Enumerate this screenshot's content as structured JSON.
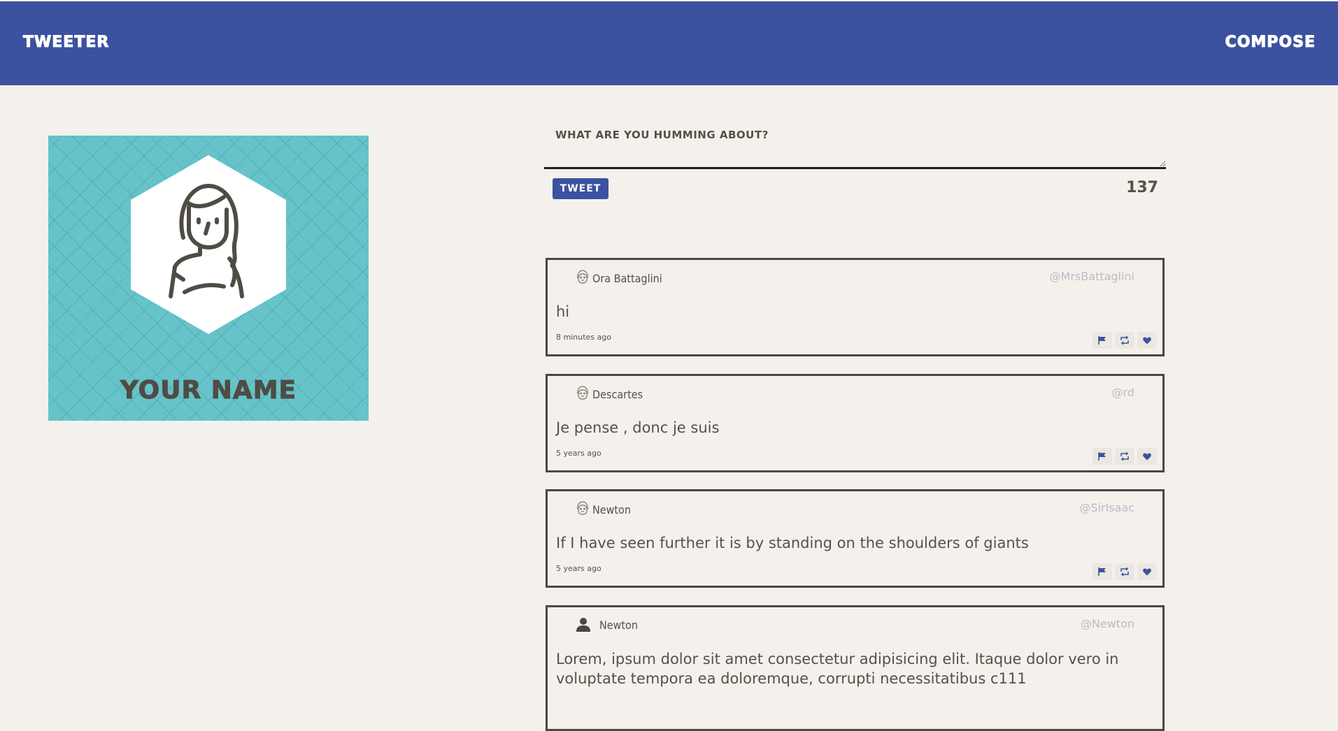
{
  "nav": {
    "logo": "Tweeter",
    "compose": "Compose"
  },
  "profile": {
    "name": "Your name",
    "avatar_icon": "woman-avatar-icon"
  },
  "composer": {
    "placeholder": "What are you humming about?",
    "value": "",
    "button_label": "Tweet",
    "remaining_chars": "137"
  },
  "colors": {
    "nav_bg": "#3b52a0",
    "page_bg": "#f4f1ec",
    "profile_bg": "#66c3c9",
    "text": "#545149",
    "handle": "#b9bcc9"
  },
  "tweets": [
    {
      "author": "Ora Battaglini",
      "handle": "@MrsBattaglini",
      "content": "hi",
      "time": "8 minutes ago",
      "avatar_icon": "face-avatar-icon"
    },
    {
      "author": "Descartes",
      "handle": "@rd",
      "content": "Je pense , donc je suis",
      "time": "5 years ago",
      "avatar_icon": "face-avatar-icon"
    },
    {
      "author": "Newton",
      "handle": "@SirIsaac",
      "content": "If I have seen further it is by standing on the shoulders of giants",
      "time": "5 years ago",
      "avatar_icon": "face-avatar-icon"
    },
    {
      "author": "Newton",
      "handle": "@Newton",
      "content": "Lorem, ipsum dolor sit amet consectetur adipisicing elit. Itaque dolor vero in voluptate tempora ea doloremque, corrupti necessitatibus c111",
      "time": "",
      "avatar_icon": "user-icon"
    }
  ],
  "actions": [
    "flag-icon",
    "retweet-icon",
    "heart-icon"
  ]
}
